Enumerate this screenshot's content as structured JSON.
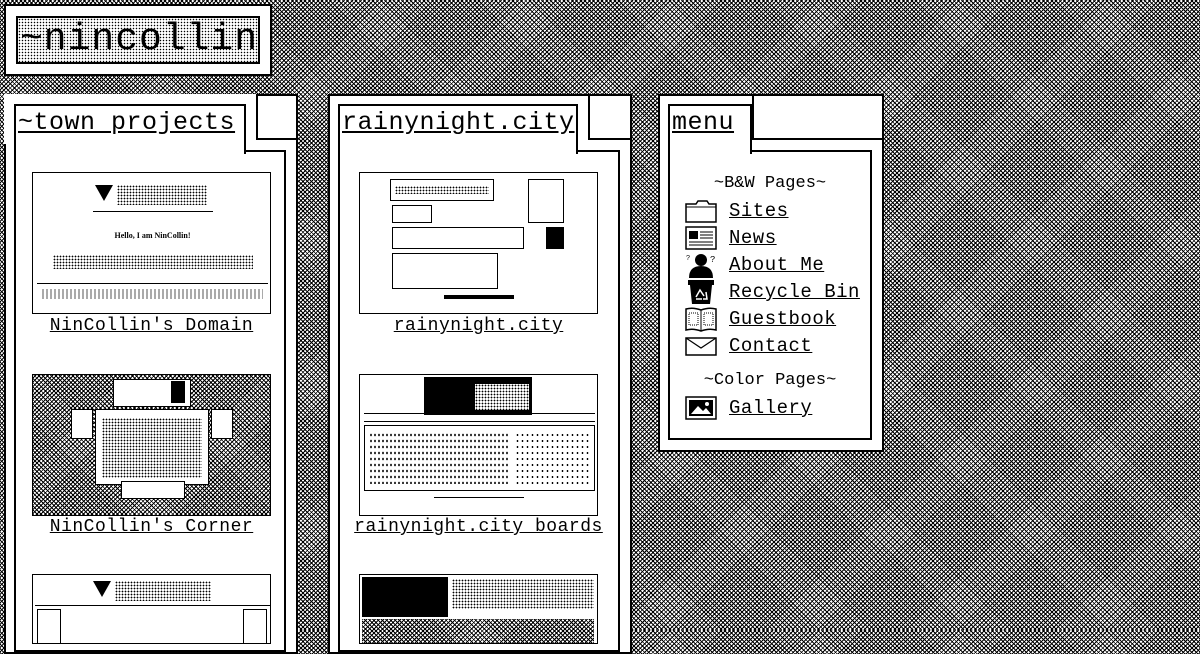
{
  "site": {
    "logo_text": "~nincollin"
  },
  "columns": [
    {
      "title": "~town projects",
      "items": [
        {
          "caption": "NinCollin's Domain",
          "thumb_heading": "Hello, I am NinCollin!"
        },
        {
          "caption": "NinCollin's Corner"
        },
        {
          "caption": ""
        }
      ]
    },
    {
      "title": "rainynight.city",
      "items": [
        {
          "caption": "rainynight.city"
        },
        {
          "caption": "rainynight.city boards"
        },
        {
          "caption": ""
        }
      ]
    }
  ],
  "menu": {
    "title": "menu",
    "bw_heading": "~B&W Pages~",
    "bw_items": [
      {
        "label": "Sites",
        "icon": "folder-icon"
      },
      {
        "label": "News",
        "icon": "newspaper-icon"
      },
      {
        "label": "About Me",
        "icon": "person-icon"
      },
      {
        "label": "Recycle Bin",
        "icon": "recycle-bin-icon"
      },
      {
        "label": "Guestbook",
        "icon": "guestbook-icon"
      },
      {
        "label": "Contact",
        "icon": "envelope-icon"
      }
    ],
    "color_heading": "~Color Pages~",
    "color_items": [
      {
        "label": "Gallery",
        "icon": "picture-icon"
      }
    ]
  },
  "colors": {
    "ink": "#000000",
    "paper": "#ffffff"
  }
}
